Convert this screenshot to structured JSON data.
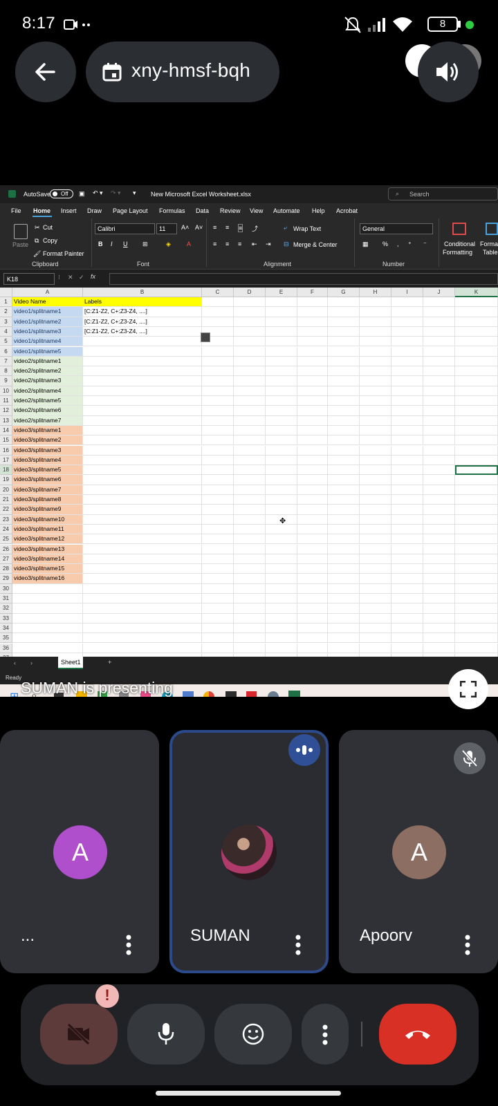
{
  "status_bar": {
    "time": "8:17",
    "battery": "8"
  },
  "meeting": {
    "code": "xny-hmsf-bqh",
    "presenting_text": "SUMAN is presenting"
  },
  "excel": {
    "autosave_label": "AutoSave",
    "autosave_state": "Off",
    "file_name": "New Microsoft Excel Worksheet.xlsx",
    "search_placeholder": "Search",
    "menu": [
      "File",
      "Home",
      "Insert",
      "Draw",
      "Page Layout",
      "Formulas",
      "Data",
      "Review",
      "View",
      "Automate",
      "Help",
      "Acrobat"
    ],
    "ribbon": {
      "cut": "Cut",
      "copy": "Copy",
      "format_painter": "Format Painter",
      "paste": "Paste",
      "font_name": "Calibri",
      "font_size": "11",
      "wrap_text": "Wrap Text",
      "merge_center": "Merge & Center",
      "number_format": "General",
      "conditional_formatting_1": "Conditional",
      "conditional_formatting_2": "Formatting",
      "format_table_1": "Format",
      "format_table_2": "Table",
      "groups": [
        "Clipboard",
        "Font",
        "Alignment",
        "Number"
      ]
    },
    "name_box": "K18",
    "columns": [
      "A",
      "B",
      "C",
      "D",
      "E",
      "F",
      "G",
      "H",
      "I",
      "J",
      "K"
    ],
    "rows": [
      [
        "1",
        "Video Name",
        "Labels"
      ],
      [
        "2",
        "video1/splitname1",
        "[C:Z1-Z2, C+:Z3-Z4, ....]"
      ],
      [
        "3",
        "video1/splitname2",
        "[C:Z1-Z2, C+:Z3-Z4, ....]"
      ],
      [
        "4",
        "video1/splitname3",
        "[C:Z1-Z2, C+:Z3-Z4, ....]"
      ],
      [
        "5",
        "video1/splitname4",
        ""
      ],
      [
        "6",
        "video1/splitname5",
        ""
      ],
      [
        "7",
        "video2/splitname1",
        ""
      ],
      [
        "8",
        "video2/splitname2",
        ""
      ],
      [
        "9",
        "video2/splitname3",
        ""
      ],
      [
        "10",
        "video2/splitname4",
        ""
      ],
      [
        "11",
        "video2/splitname5",
        ""
      ],
      [
        "12",
        "video2/splitname6",
        ""
      ],
      [
        "13",
        "video2/splitname7",
        ""
      ],
      [
        "14",
        "video3/splitname1",
        ""
      ],
      [
        "15",
        "video3/splitname2",
        ""
      ],
      [
        "16",
        "video3/splitname3",
        ""
      ],
      [
        "17",
        "video3/splitname4",
        ""
      ],
      [
        "18",
        "video3/splitname5",
        ""
      ],
      [
        "19",
        "video3/splitname6",
        ""
      ],
      [
        "20",
        "video3/splitname7",
        ""
      ],
      [
        "21",
        "video3/splitname8",
        ""
      ],
      [
        "22",
        "video3/splitname9",
        ""
      ],
      [
        "23",
        "video3/splitname10",
        ""
      ],
      [
        "24",
        "video3/splitname11",
        ""
      ],
      [
        "25",
        "video3/splitname12",
        ""
      ],
      [
        "26",
        "video3/splitname13",
        ""
      ],
      [
        "27",
        "video3/splitname14",
        ""
      ],
      [
        "28",
        "video3/splitname15",
        ""
      ],
      [
        "29",
        "video3/splitname16",
        ""
      ],
      [
        "30",
        "",
        ""
      ],
      [
        "31",
        "",
        ""
      ],
      [
        "32",
        "",
        ""
      ],
      [
        "33",
        "",
        ""
      ],
      [
        "34",
        "",
        ""
      ],
      [
        "35",
        "",
        ""
      ],
      [
        "36",
        "",
        ""
      ],
      [
        "37",
        "",
        ""
      ]
    ],
    "sheet_tab": "Sheet1",
    "status": "Ready",
    "colors": {
      "header_fill": "#ffff00",
      "video1_fill": "#c5d9f1",
      "video2_fill": "#e2efda",
      "video3_fill": "#f8cbad"
    }
  },
  "participants": [
    {
      "initial": "A",
      "name": "...",
      "avatar_color": "#b04fcb"
    },
    {
      "initial": "",
      "name": "SUMAN",
      "avatar_color": "#4a2a2a",
      "speaking": true
    },
    {
      "initial": "A",
      "name": "Apoorv",
      "avatar_color": "#8d6e63",
      "muted": true
    }
  ],
  "controls": {
    "end_call_color": "#d93025",
    "camera_off_color": "#5c3b3a",
    "alert_symbol": "!"
  }
}
